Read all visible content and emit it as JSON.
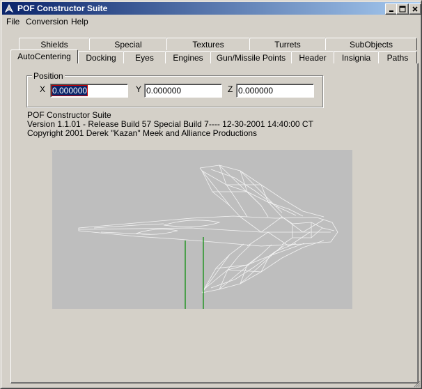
{
  "window": {
    "title": "POF Constructor Suite"
  },
  "menu": [
    "File",
    "Conversion",
    "Help"
  ],
  "tabs_back": [
    "Shields",
    "Special",
    "Textures",
    "Turrets",
    "SubObjects"
  ],
  "tabs_front": [
    "AutoCentering",
    "Docking",
    "Eyes",
    "Engines",
    "Gun/Missile Points",
    "Header",
    "Insignia",
    "Paths"
  ],
  "position": {
    "group_label": "Position",
    "x_label": "X",
    "x_value": "0.000000",
    "y_label": "Y",
    "y_value": "0.000000",
    "z_label": "Z",
    "z_value": "0.000000"
  },
  "about": {
    "line1": "POF Constructor Suite",
    "line2": "Version 1.1.01 - Release Build 57 Special Build 7---- 12-30-2001 14:40:00 CT",
    "line3": "Copyright 2001 Derek \"Kazan\" Meek and Alliance Productions"
  },
  "icons": {
    "minimize": "minimize-icon",
    "maximize": "maximize-icon",
    "close": "close-icon"
  }
}
